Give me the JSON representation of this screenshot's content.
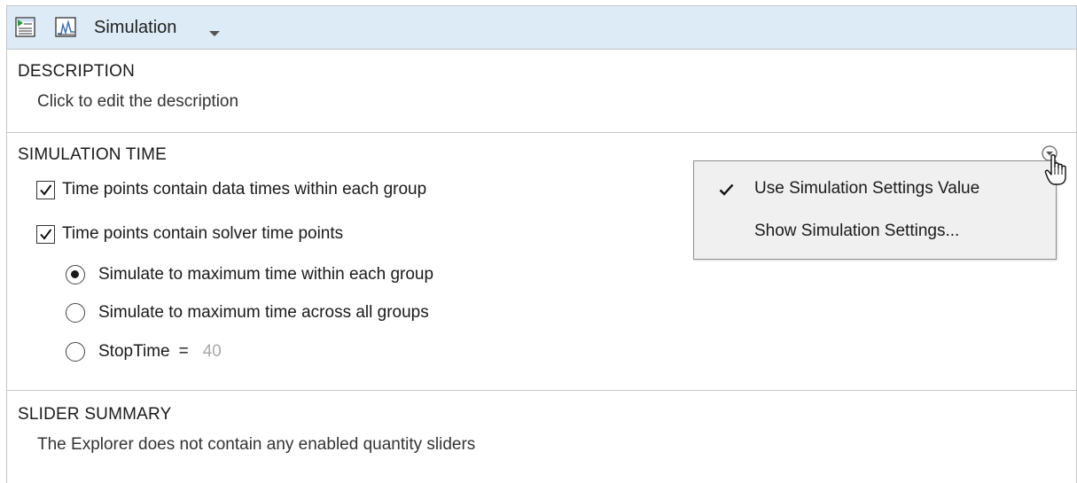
{
  "header": {
    "title": "Simulation",
    "icons": [
      "data-sheet-icon",
      "plot-icon",
      "dropdown-caret-icon"
    ]
  },
  "description": {
    "heading": "DESCRIPTION",
    "placeholder_text": "Click to edit the description"
  },
  "simulation_time": {
    "heading": "SIMULATION TIME",
    "checkboxes": [
      {
        "label": "Time points contain data times within each group",
        "checked": true
      },
      {
        "label": "Time points contain solver time points",
        "checked": true
      }
    ],
    "radios": [
      {
        "label": "Simulate to maximum time within each group",
        "selected": true
      },
      {
        "label": "Simulate to maximum time across all groups",
        "selected": false
      },
      {
        "label": "StopTime",
        "selected": false
      }
    ],
    "stoptime_equals": "=",
    "stoptime_value": "40"
  },
  "options_menu": {
    "items": [
      {
        "label": "Use Simulation Settings Value",
        "checked": true
      },
      {
        "label": "Show Simulation Settings...",
        "checked": false
      }
    ]
  },
  "slider_summary": {
    "heading": "SLIDER SUMMARY",
    "text": "The Explorer does not contain any enabled quantity sliders"
  },
  "colors": {
    "header_bg": "#dcebf6",
    "popup_bg": "#f0f0f0",
    "disabled_value": "#a8a8a8"
  }
}
